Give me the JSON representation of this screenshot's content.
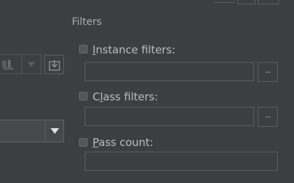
{
  "filters": {
    "title": "Filters",
    "instance_filters": {
      "first": "I",
      "rest": "nstance filters:",
      "more_label": "..."
    },
    "class_filters": {
      "first": "l",
      "prefix": "C",
      "rest": "ass filters:",
      "more_label": "..."
    },
    "pass_count": {
      "first": "P",
      "rest": "ass count:"
    }
  },
  "icons": [
    "dropdown-arrow-icon",
    "import-icon",
    "more-icon"
  ]
}
